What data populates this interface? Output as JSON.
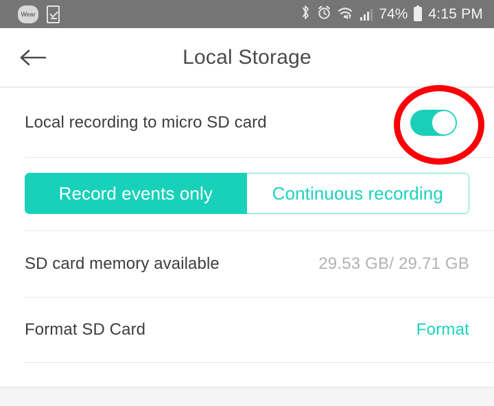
{
  "status_bar": {
    "background": "#757575",
    "left_icons": [
      {
        "name": "wear-badge-icon",
        "label": "Wear"
      },
      {
        "name": "checklist-phone-icon",
        "label": ""
      }
    ],
    "bluetooth_glyph": "ᛗ",
    "alarm_glyph": "⏰",
    "wifi_glyph": "◢",
    "battery_percent": "74%",
    "time": "4:15 PM"
  },
  "header": {
    "back_label": "←",
    "title": "Local Storage"
  },
  "rows": {
    "local_recording": {
      "label": "Local recording to micro SD card",
      "toggle_state": "on",
      "toggle_on_color": "#19cfb8"
    },
    "sd_memory": {
      "label": "SD card memory available",
      "value": "29.53 GB/ 29.71 GB"
    },
    "format": {
      "label": "Format SD Card",
      "action": "Format",
      "action_color": "#19d3bb"
    }
  },
  "recording_mode": {
    "options": [
      {
        "label": "Record events only",
        "selected": true
      },
      {
        "label": "Continuous recording",
        "selected": false
      }
    ],
    "accent_color": "#17d1b9"
  },
  "annotation": {
    "shape": "circle",
    "color": "#fb0007",
    "targets": "local-recording-toggle"
  }
}
